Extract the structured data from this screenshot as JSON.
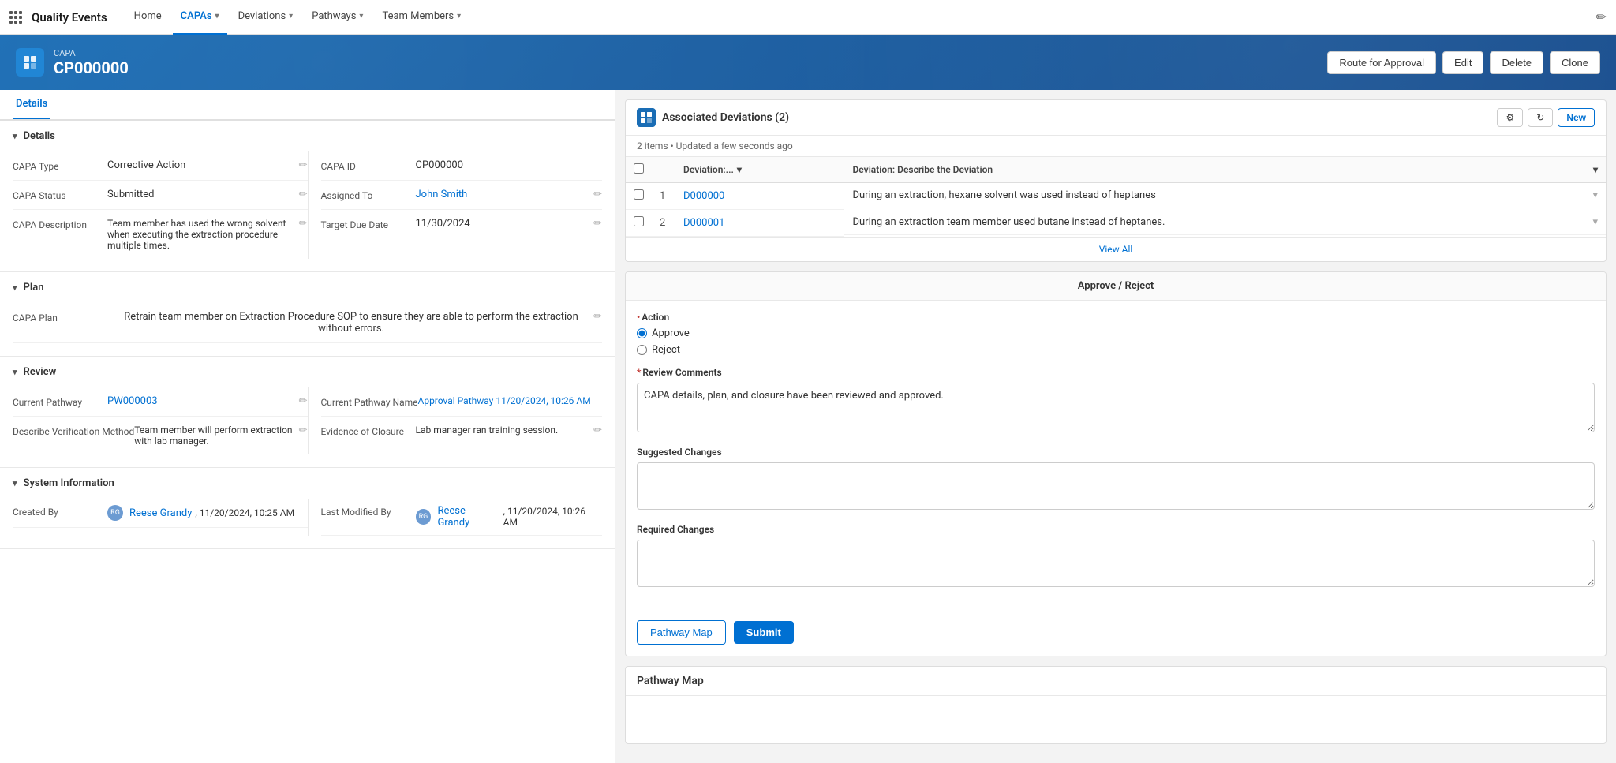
{
  "app": {
    "title": "Quality Events",
    "edit_icon": "✏"
  },
  "nav": {
    "items": [
      {
        "label": "Home",
        "active": false
      },
      {
        "label": "CAPAs",
        "has_dropdown": true,
        "active": true
      },
      {
        "label": "Deviations",
        "has_dropdown": true,
        "active": false
      },
      {
        "label": "Pathways",
        "has_dropdown": true,
        "active": false
      },
      {
        "label": "Team Members",
        "has_dropdown": true,
        "active": false
      }
    ]
  },
  "header": {
    "capa_label": "CAPA",
    "capa_id": "CP000000",
    "icon": "⚑",
    "buttons": {
      "route": "Route for Approval",
      "edit": "Edit",
      "delete": "Delete",
      "clone": "Clone"
    }
  },
  "left_panel": {
    "tab": "Details",
    "sections": {
      "details": {
        "title": "Details",
        "fields": {
          "capa_type_label": "CAPA Type",
          "capa_type_value": "Corrective Action",
          "capa_id_label": "CAPA ID",
          "capa_id_value": "CP000000",
          "capa_status_label": "CAPA Status",
          "capa_status_value": "Submitted",
          "assigned_to_label": "Assigned To",
          "assigned_to_value": "John Smith",
          "capa_desc_label": "CAPA Description",
          "capa_desc_value": "Team member has used the wrong solvent when executing the extraction procedure multiple times.",
          "target_due_label": "Target Due Date",
          "target_due_value": "11/30/2024"
        }
      },
      "plan": {
        "title": "Plan",
        "capa_plan_label": "CAPA Plan",
        "capa_plan_value": "Retrain team member on Extraction Procedure SOP to ensure they are able to perform the extraction without errors."
      },
      "review": {
        "title": "Review",
        "fields": {
          "current_pathway_label": "Current Pathway",
          "current_pathway_value": "PW000003",
          "current_pathway_name_label": "Current Pathway Name",
          "current_pathway_name_value": "Approval Pathway 11/20/2024, 10:26 AM",
          "verification_label": "Describe Verification Method",
          "verification_value": "Team member will perform extraction with lab manager.",
          "evidence_label": "Evidence of Closure",
          "evidence_value": "Lab manager ran training session."
        }
      },
      "system_info": {
        "title": "System Information",
        "created_by_label": "Created By",
        "created_by_value": "Reese Grandy",
        "created_by_date": ", 11/20/2024, 10:25 AM",
        "last_modified_label": "Last Modified By",
        "last_modified_value": "Reese Grandy",
        "last_modified_date": ", 11/20/2024, 10:26 AM"
      }
    }
  },
  "right_panel": {
    "associated_deviations": {
      "title": "Associated Deviations (2)",
      "subtitle": "2 items • Updated a few seconds ago",
      "new_label": "New",
      "col_deviation": "Deviation:...",
      "col_description": "Deviation: Describe the Deviation",
      "view_all": "View All",
      "rows": [
        {
          "num": 1,
          "id": "D000000",
          "description": "During an extraction, hexane solvent was used instead of heptanes"
        },
        {
          "num": 2,
          "id": "D000001",
          "description": "During an extraction team member used butane instead of heptanes."
        }
      ]
    },
    "approve_reject": {
      "title": "Approve / Reject",
      "action_label": "Action",
      "action_required": true,
      "options": [
        "Approve",
        "Reject"
      ],
      "default_option": "Approve",
      "review_comments_label": "Review Comments",
      "review_comments_required": true,
      "review_comments_value": "CAPA details, plan, and closure have been reviewed and approved.",
      "suggested_changes_label": "Suggested Changes",
      "suggested_changes_value": "",
      "required_changes_label": "Required Changes",
      "required_changes_value": "",
      "pathway_map_btn": "Pathway Map",
      "submit_btn": "Submit"
    },
    "pathway_map": {
      "title": "Pathway Map"
    }
  }
}
